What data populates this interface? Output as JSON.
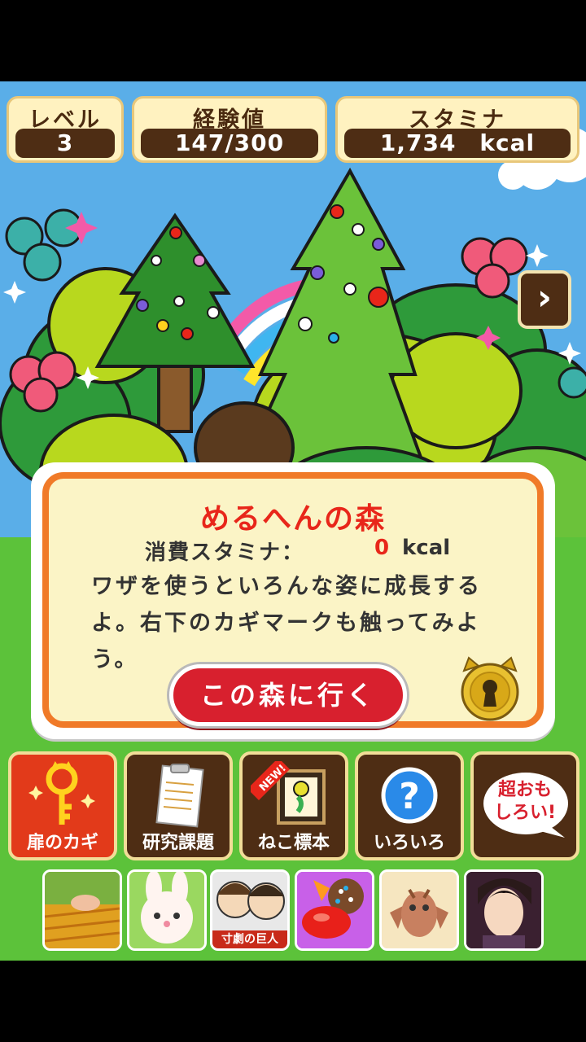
{
  "stats": {
    "level": {
      "label": "レベル",
      "value": "3"
    },
    "exp": {
      "label": "経験値",
      "value": "147/300"
    },
    "stamina": {
      "label": "スタミナ",
      "value": "1,734　kcal"
    }
  },
  "next_button": "›",
  "dialog": {
    "title": "めるへんの森",
    "cost_label": "消費スタミナ：",
    "cost_value": "0",
    "cost_unit": "kcal",
    "body": "ワザを使うといろんな姿に成長するよ。右下のカギマークも触ってみよう。",
    "go_button": "この森に行く"
  },
  "menu": [
    {
      "label": "扉のカギ",
      "icon": "key-icon"
    },
    {
      "label": "研究課題",
      "icon": "clipboard-icon"
    },
    {
      "label": "ねこ標本",
      "icon": "specimen-frame-icon",
      "badge": "NEW!"
    },
    {
      "label": "いろいろ",
      "icon": "question-icon"
    },
    {
      "label": "超おもしろい!",
      "icon": "speech-bubble-icon"
    }
  ],
  "ads": [
    {
      "name": "farm-game-ad",
      "caption": ""
    },
    {
      "name": "bunny-game-ad",
      "caption": ""
    },
    {
      "name": "chibi-giant-ad",
      "caption": "寸劇の巨人"
    },
    {
      "name": "candy-game-ad",
      "caption": ""
    },
    {
      "name": "dragon-game-ad",
      "caption": ""
    },
    {
      "name": "romance-game-ad",
      "caption": ""
    }
  ],
  "colors": {
    "accent_red": "#e8261a",
    "panel_brown": "#4e2d14",
    "orange_border": "#f07a28"
  }
}
